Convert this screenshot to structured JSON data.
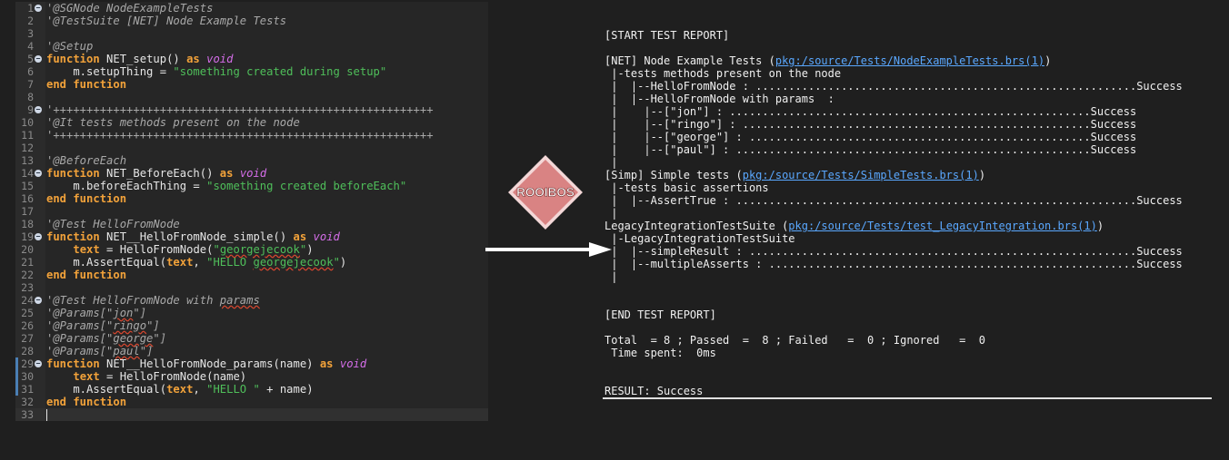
{
  "editor": {
    "lines": [
      {
        "n": "1",
        "fold": true,
        "segs": [
          {
            "c": "cm",
            "t": "'@SGNode NodeExampleTests"
          }
        ]
      },
      {
        "n": "2",
        "segs": [
          {
            "c": "cm",
            "t": "'@TestSuite [NET] Node Example Tests"
          }
        ]
      },
      {
        "n": "3",
        "segs": []
      },
      {
        "n": "4",
        "segs": [
          {
            "c": "cm",
            "t": "'@Setup"
          }
        ]
      },
      {
        "n": "5",
        "fold": true,
        "segs": [
          {
            "c": "kw",
            "t": "function"
          },
          {
            "t": " NET_setup() "
          },
          {
            "c": "kw",
            "t": "as"
          },
          {
            "t": " "
          },
          {
            "c": "ty",
            "t": "void"
          }
        ]
      },
      {
        "n": "6",
        "segs": [
          {
            "t": "    m.setupThing = "
          },
          {
            "c": "st",
            "t": "\"something created during setup\""
          }
        ]
      },
      {
        "n": "7",
        "segs": [
          {
            "c": "kw",
            "t": "end function"
          }
        ]
      },
      {
        "n": "8",
        "segs": []
      },
      {
        "n": "9",
        "fold": true,
        "segs": [
          {
            "c": "cm",
            "t": "'+++++++++++++++++++++++++++++++++++++++++++++++++++++++++"
          }
        ]
      },
      {
        "n": "10",
        "segs": [
          {
            "c": "cm",
            "t": "'@It tests methods present on the node"
          }
        ]
      },
      {
        "n": "11",
        "segs": [
          {
            "c": "cm",
            "t": "'+++++++++++++++++++++++++++++++++++++++++++++++++++++++++"
          }
        ]
      },
      {
        "n": "12",
        "segs": []
      },
      {
        "n": "13",
        "segs": [
          {
            "c": "cm",
            "t": "'@BeforeEach"
          }
        ]
      },
      {
        "n": "14",
        "fold": true,
        "segs": [
          {
            "c": "kw",
            "t": "function"
          },
          {
            "t": " NET_BeforeEach() "
          },
          {
            "c": "kw",
            "t": "as"
          },
          {
            "t": " "
          },
          {
            "c": "ty",
            "t": "void"
          }
        ]
      },
      {
        "n": "15",
        "segs": [
          {
            "t": "    m.beforeEachThing = "
          },
          {
            "c": "st",
            "t": "\"something created beforeEach\""
          }
        ]
      },
      {
        "n": "16",
        "segs": [
          {
            "c": "kw",
            "t": "end function"
          }
        ]
      },
      {
        "n": "17",
        "segs": []
      },
      {
        "n": "18",
        "segs": [
          {
            "c": "cm",
            "t": "'@Test HelloFromNode"
          }
        ]
      },
      {
        "n": "19",
        "fold": true,
        "segs": [
          {
            "c": "kw",
            "t": "function"
          },
          {
            "t": " NET__HelloFromNode_simple() "
          },
          {
            "c": "kw",
            "t": "as"
          },
          {
            "t": " "
          },
          {
            "c": "ty",
            "t": "void"
          }
        ]
      },
      {
        "n": "20",
        "segs": [
          {
            "t": "    "
          },
          {
            "c": "kw",
            "t": "text"
          },
          {
            "t": " = HelloFromNode("
          },
          {
            "c": "st",
            "t": "\""
          },
          {
            "c": "st sq",
            "t": "georgejecook"
          },
          {
            "c": "st",
            "t": "\""
          },
          {
            "t": ")"
          }
        ]
      },
      {
        "n": "21",
        "segs": [
          {
            "t": "    m.AssertEqual("
          },
          {
            "c": "kw",
            "t": "text"
          },
          {
            "t": ", "
          },
          {
            "c": "st",
            "t": "\"HELLO "
          },
          {
            "c": "st sq",
            "t": "georgejecook"
          },
          {
            "c": "st",
            "t": "\""
          },
          {
            "t": ")"
          }
        ]
      },
      {
        "n": "22",
        "segs": [
          {
            "c": "kw",
            "t": "end function"
          }
        ]
      },
      {
        "n": "23",
        "segs": []
      },
      {
        "n": "24",
        "fold": true,
        "segs": [
          {
            "c": "cm",
            "t": "'@Test HelloFromNode with "
          },
          {
            "c": "cm sq",
            "t": "params"
          }
        ]
      },
      {
        "n": "25",
        "segs": [
          {
            "c": "cm",
            "t": "'@Params[\""
          },
          {
            "c": "cm sq",
            "t": "jon"
          },
          {
            "c": "cm",
            "t": "\"]"
          }
        ]
      },
      {
        "n": "26",
        "segs": [
          {
            "c": "cm",
            "t": "'@Params[\""
          },
          {
            "c": "cm sq",
            "t": "ringo"
          },
          {
            "c": "cm",
            "t": "\"]"
          }
        ]
      },
      {
        "n": "27",
        "segs": [
          {
            "c": "cm",
            "t": "'@Params[\""
          },
          {
            "c": "cm sq",
            "t": "george"
          },
          {
            "c": "cm",
            "t": "\"]"
          }
        ]
      },
      {
        "n": "28",
        "segs": [
          {
            "c": "cm",
            "t": "'@Params[\""
          },
          {
            "c": "cm sq",
            "t": "paul"
          },
          {
            "c": "cm",
            "t": "\"]"
          }
        ]
      },
      {
        "n": "29",
        "fold": true,
        "mark": true,
        "segs": [
          {
            "c": "kw",
            "t": "function"
          },
          {
            "t": " NET__HelloFromNode_params(name) "
          },
          {
            "c": "kw",
            "t": "as"
          },
          {
            "t": " "
          },
          {
            "c": "ty",
            "t": "void"
          }
        ]
      },
      {
        "n": "30",
        "mark": true,
        "segs": [
          {
            "t": "    "
          },
          {
            "c": "kw",
            "t": "text"
          },
          {
            "t": " = HelloFromNode(name)"
          }
        ]
      },
      {
        "n": "31",
        "mark": true,
        "segs": [
          {
            "t": "    m.AssertEqual("
          },
          {
            "c": "kw",
            "t": "text"
          },
          {
            "t": ", "
          },
          {
            "c": "st",
            "t": "\"HELLO \""
          },
          {
            "t": " + name)"
          }
        ]
      },
      {
        "n": "32",
        "segs": [
          {
            "c": "kw",
            "t": "end function"
          }
        ]
      },
      {
        "n": "33",
        "current": true,
        "segs": []
      }
    ]
  },
  "logo": {
    "text": "ROOIBOS",
    "fill": "#d98383",
    "stroke": "#f3d7d7",
    "text_fill": "#ffffff"
  },
  "report": {
    "lines": [
      [
        {
          "t": "[START TEST REPORT]"
        }
      ],
      [],
      [
        {
          "t": "[NET] Node Example Tests ("
        },
        {
          "l": 1,
          "t": "pkg:/source/Tests/NodeExampleTests.brs(1)"
        },
        {
          "t": ")"
        }
      ],
      [
        {
          "t": " |-tests methods present on the node"
        }
      ],
      [
        {
          "t": " |  |--HelloFromNode : ..........................................................Success"
        }
      ],
      [
        {
          "t": " |  |--HelloFromNode with params  :"
        }
      ],
      [
        {
          "t": " |    |--[\"jon\"] : .......................................................Success"
        }
      ],
      [
        {
          "t": " |    |--[\"ringo\"] : .....................................................Success"
        }
      ],
      [
        {
          "t": " |    |--[\"george\"] : ....................................................Success"
        }
      ],
      [
        {
          "t": " |    |--[\"paul\"] : ......................................................Success"
        }
      ],
      [
        {
          "t": " |"
        }
      ],
      [
        {
          "t": "[Simp] Simple tests ("
        },
        {
          "l": 1,
          "t": "pkg:/source/Tests/SimpleTests.brs(1)"
        },
        {
          "t": ")"
        }
      ],
      [
        {
          "t": " |-tests basic assertions"
        }
      ],
      [
        {
          "t": " |  |--AssertTrue : .............................................................Success"
        }
      ],
      [
        {
          "t": " |"
        }
      ],
      [
        {
          "t": "LegacyIntegrationTestSuite ("
        },
        {
          "l": 1,
          "t": "pkg:/source/Tests/test_LegacyIntegration.brs(1)"
        },
        {
          "t": ")"
        }
      ],
      [
        {
          "t": " |-LegacyIntegrationTestSuite"
        }
      ],
      [
        {
          "t": " |  |--simpleResult : ...........................................................Success"
        }
      ],
      [
        {
          "t": " |  |--multipleAsserts : ........................................................Success"
        }
      ],
      [
        {
          "t": " |"
        }
      ],
      [],
      [],
      [
        {
          "t": "[END TEST REPORT]"
        }
      ],
      [],
      [
        {
          "t": "Total  = 8 ; Passed  =  8 ; Failed   =  0 ; Ignored   =  0"
        }
      ],
      [
        {
          "t": " Time spent:  0ms"
        }
      ],
      [],
      [],
      [
        {
          "t": "RESULT: Success"
        }
      ]
    ]
  }
}
